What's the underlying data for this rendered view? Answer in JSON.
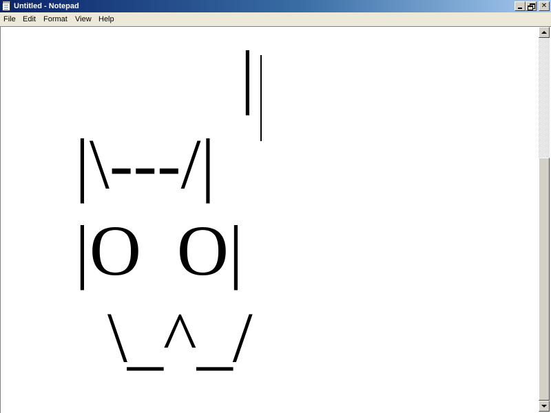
{
  "window": {
    "title": "Untitled - Notepad",
    "title_bar_color": "#0a246a",
    "icon": "notepad-icon",
    "buttons": {
      "minimize_icon": "minimize-icon",
      "restore_icon": "restore-icon",
      "close_label": "✕"
    }
  },
  "menubar": {
    "items": [
      {
        "label": "File"
      },
      {
        "label": "Edit"
      },
      {
        "label": "Format"
      },
      {
        "label": "View"
      },
      {
        "label": "Help"
      }
    ]
  },
  "editor": {
    "lines": [
      "|",
      "|\\---/|",
      "|O  O|",
      " \\_^_/"
    ],
    "text_color": "#000000",
    "background": "#ffffff"
  },
  "scrollbar": {
    "up_icon": "scroll-up-arrow-icon",
    "down_icon": "scroll-down-arrow-icon"
  }
}
